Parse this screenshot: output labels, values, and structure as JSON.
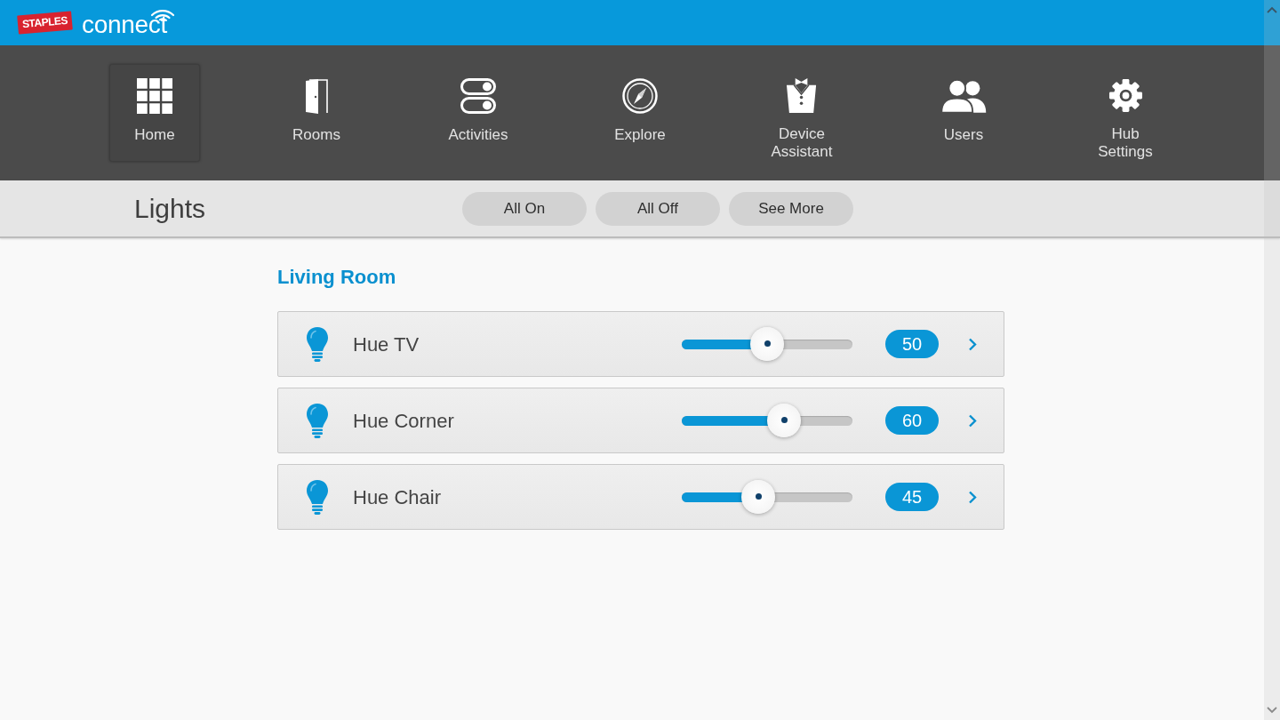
{
  "header": {
    "brand_badge": "STAPLES",
    "brand_name": "connect"
  },
  "nav": [
    {
      "kind": "home",
      "label": "Home",
      "selected": true
    },
    {
      "kind": "rooms",
      "label": "Rooms",
      "selected": false
    },
    {
      "kind": "activities",
      "label": "Activities",
      "selected": false
    },
    {
      "kind": "explore",
      "label": "Explore",
      "selected": false
    },
    {
      "kind": "assistant",
      "label": "Device Assistant",
      "selected": false
    },
    {
      "kind": "users",
      "label": "Users",
      "selected": false
    },
    {
      "kind": "settings",
      "label": "Hub Settings",
      "selected": false
    }
  ],
  "toolbar": {
    "title": "Lights",
    "buttons": [
      "All On",
      "All Off",
      "See More"
    ]
  },
  "section": {
    "title": "Living Room",
    "lights": [
      {
        "name": "Hue TV",
        "level": 0.5,
        "value": "50"
      },
      {
        "name": "Hue Corner",
        "level": 0.6,
        "value": "60"
      },
      {
        "name": "Hue Chair",
        "level": 0.45,
        "value": "45"
      }
    ]
  }
}
